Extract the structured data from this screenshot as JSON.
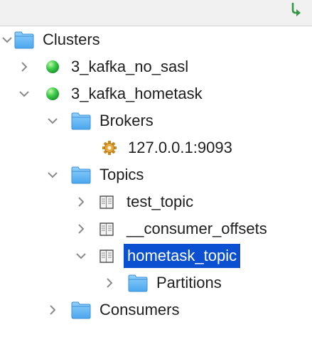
{
  "toolbar": {
    "refresh_icon": "refresh-arrow-icon"
  },
  "tree": {
    "clusters_label": "Clusters",
    "cluster_1": {
      "label": "3_kafka_no_sasl",
      "status": "connected"
    },
    "cluster_2": {
      "label": "3_kafka_hometask",
      "status": "connected",
      "brokers_label": "Brokers",
      "broker_1": "127.0.0.1:9093",
      "topics_label": "Topics",
      "topic_1": "test_topic",
      "topic_2": "__consumer_offsets",
      "topic_3": "hometask_topic",
      "partitions_label": "Partitions",
      "consumers_label": "Consumers"
    },
    "selected_item": "hometask_topic"
  },
  "colors": {
    "selection": "#0a50d0",
    "status_green": "#22b33a",
    "folder": "#5ab3f2",
    "text": "#1e1e1e"
  }
}
